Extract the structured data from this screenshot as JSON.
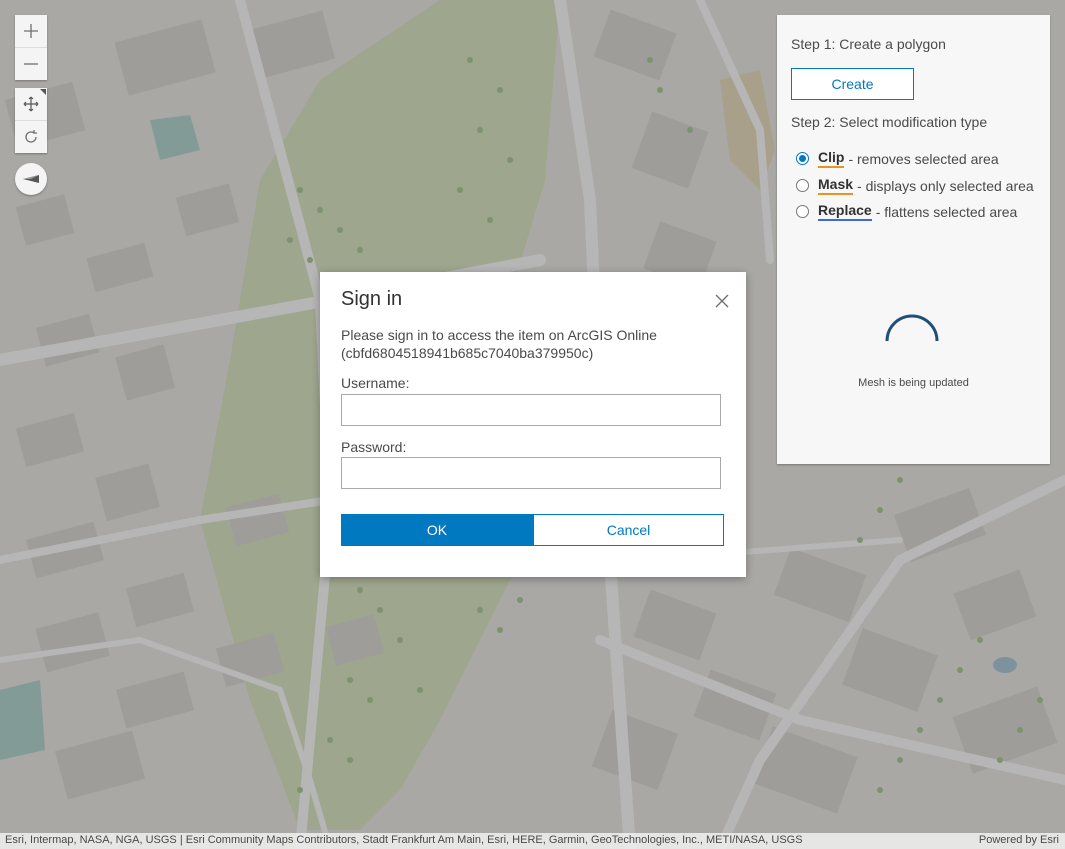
{
  "map": {
    "controls": {
      "zoom_in_icon": "plus-icon",
      "zoom_out_icon": "minus-icon",
      "pan_icon": "move-icon",
      "rotate_icon": "rotate-icon",
      "compass_icon": "compass-icon"
    },
    "colors": {
      "base": "#e9e7e2",
      "building": "#d6d3cd",
      "road": "#ffffff",
      "park": "#d6e4b8",
      "tree": "#9ec281"
    }
  },
  "panel": {
    "step1_label": "Step 1: Create a polygon",
    "create_label": "Create",
    "step2_label": "Step 2: Select modification type",
    "options": [
      {
        "name": "Clip",
        "desc": "- removes selected area",
        "checked": true,
        "underline": "#e6951e"
      },
      {
        "name": "Mask",
        "desc": "- displays only selected area",
        "checked": false,
        "underline": "#e6951e"
      },
      {
        "name": "Replace",
        "desc": "- flattens selected area",
        "checked": false,
        "underline": "#3d6bd1"
      }
    ],
    "status": "Mesh is being updated"
  },
  "dialog": {
    "title": "Sign in",
    "message_line1": "Please sign in to access the item on ArcGIS Online",
    "message_line2": "(cbfd6804518941b685c7040ba379950c)",
    "username_label": "Username:",
    "username_value": "",
    "password_label": "Password:",
    "password_value": "",
    "ok_label": "OK",
    "cancel_label": "Cancel",
    "close_icon": "close-icon"
  },
  "attribution": {
    "sources": "Esri, Intermap, NASA, NGA, USGS | Esri Community Maps Contributors, Stadt Frankfurt Am Main, Esri, HERE, Garmin, GeoTechnologies, Inc., METI/NASA, USGS",
    "powered_by": "Powered by Esri"
  },
  "accent_color": "#0079c1"
}
